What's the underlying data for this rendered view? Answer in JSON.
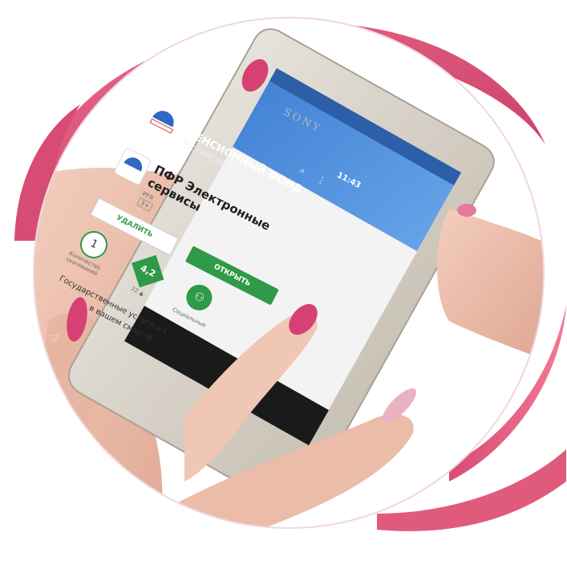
{
  "colors": {
    "ribbon_pink": "#e05577",
    "ribbon_pink_dark": "#c9406a",
    "phone_frame": "#d7d3cc",
    "screen_blue": "#4b8bd8",
    "play_green": "#2f9a47",
    "nail_pink": "#d64072",
    "skin": "#efc2b1"
  },
  "phone": {
    "brand": "SONY",
    "status_time": "11:43"
  },
  "app_banner": {
    "title": "ПЕНСИОННЫЙ ФОНД",
    "subtitle": "РОССИЙСКОЙ ФЕДЕРАЦИИ"
  },
  "app": {
    "title_line1": "ПФР Электронные",
    "title_line2": "сервисы",
    "developer": "PFR",
    "age_badge": "3+",
    "delete_button": "УДАЛИТЬ",
    "open_button": "ОТКРЫТЬ",
    "stats": [
      {
        "value": "1",
        "label_line1": "Количество",
        "label_line2": "скачиваний"
      },
      {
        "value": "4,2",
        "label_line1": "22 ▲",
        "label_line2": ""
      },
      {
        "value": "",
        "label_line1": "Социальные",
        "label_line2": ""
      }
    ],
    "description_line1": "Государственные услуги и с",
    "description_line2": "в вашем смартф"
  },
  "icons": {
    "back": "back-arrow-icon",
    "search": "search-icon",
    "more": "more-vert-icon",
    "people": "people-icon",
    "nav_back": "nav-back-icon",
    "nav_home": "nav-home-icon"
  }
}
